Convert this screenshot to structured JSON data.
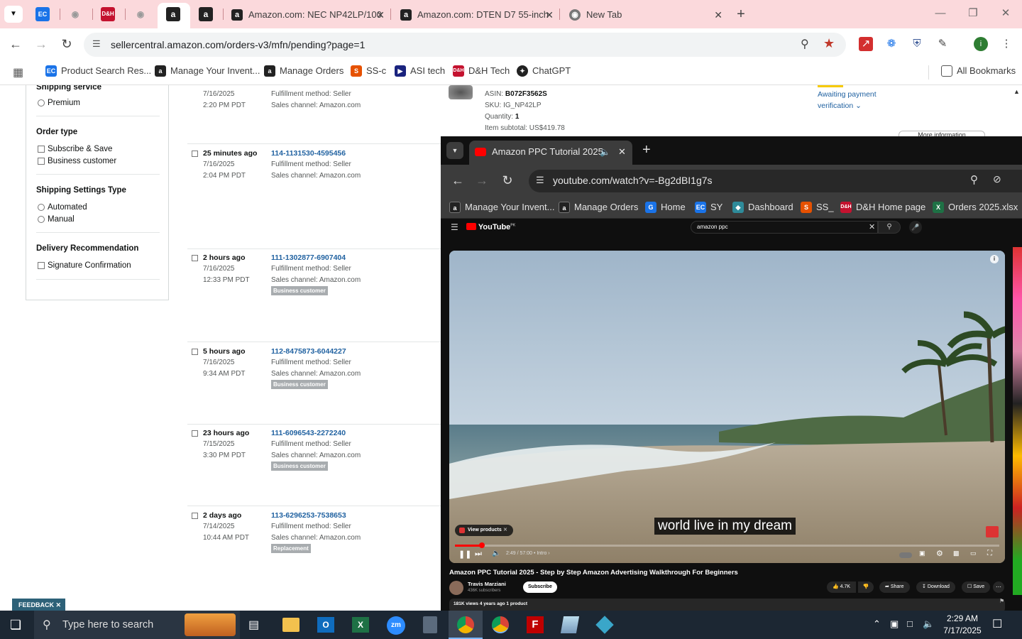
{
  "browser": {
    "tabs": [
      {
        "label": "Amazon.com: NEC NP42LP/100"
      },
      {
        "label": "Amazon.com: DTEN D7 55-inch"
      },
      {
        "label": "New Tab"
      }
    ],
    "url": "sellercentral.amazon.com/orders-v3/mfn/pending?page=1",
    "bookmarks": [
      {
        "label": "Product Search Res..."
      },
      {
        "label": "Manage Your Invent..."
      },
      {
        "label": "Manage Orders"
      },
      {
        "label": "SS-c"
      },
      {
        "label": "ASI tech"
      },
      {
        "label": "D&H Tech"
      },
      {
        "label": "ChatGPT"
      }
    ],
    "all_bookmarks": "All Bookmarks"
  },
  "filters": {
    "shipping_service": {
      "heading": "Shipping service",
      "options": [
        "Premium"
      ]
    },
    "order_type": {
      "heading": "Order type",
      "options": [
        "Subscribe & Save",
        "Business customer"
      ]
    },
    "shipping_settings": {
      "heading": "Shipping Settings Type",
      "options": [
        "Automated",
        "Manual"
      ]
    },
    "delivery": {
      "heading": "Delivery Recommendation",
      "options": [
        "Signature Confirmation"
      ]
    }
  },
  "top_order": {
    "date": "7/16/2025",
    "time": "2:20 PM PDT",
    "method": "Fulfillment method: Seller",
    "channel": "Sales channel: Amazon.com",
    "asin_label": "ASIN:",
    "asin": "B072F3562S",
    "sku": "SKU: IG_NP42LP",
    "quantity_label": "Quantity:",
    "quantity": "1",
    "subtotal": "Item subtotal: US$419.78",
    "status_line1": "Awaiting payment",
    "status_line2": "verification",
    "more_info": "More information"
  },
  "orders": [
    {
      "when": "25 minutes ago",
      "date": "7/16/2025",
      "time": "2:04 PM PDT",
      "id": "114-1131530-4595456",
      "method": "Fulfillment method: Seller",
      "channel": "Sales channel: Amazon.com",
      "badge": ""
    },
    {
      "when": "2 hours ago",
      "date": "7/16/2025",
      "time": "12:33 PM PDT",
      "id": "111-1302877-6907404",
      "method": "Fulfillment method: Seller",
      "channel": "Sales channel: Amazon.com",
      "badge": "Business customer"
    },
    {
      "when": "5 hours ago",
      "date": "7/16/2025",
      "time": "9:34 AM PDT",
      "id": "112-8475873-6044227",
      "method": "Fulfillment method: Seller",
      "channel": "Sales channel: Amazon.com",
      "badge": "Business customer"
    },
    {
      "when": "23 hours ago",
      "date": "7/15/2025",
      "time": "3:30 PM PDT",
      "id": "111-6096543-2272240",
      "method": "Fulfillment method: Seller",
      "channel": "Sales channel: Amazon.com",
      "badge": "Business customer"
    },
    {
      "when": "2 days ago",
      "date": "7/14/2025",
      "time": "10:44 AM PDT",
      "id": "113-6296253-7538653",
      "method": "Fulfillment method: Seller",
      "channel": "Sales channel: Amazon.com",
      "badge": "Replacement"
    }
  ],
  "feedback": "FEEDBACK",
  "youtube_window": {
    "tab_title": "Amazon PPC Tutorial 2025",
    "url": "youtube.com/watch?v=-Bg2dBI1g7s",
    "bookmarks": [
      {
        "label": "Manage Your Invent..."
      },
      {
        "label": "Manage Orders"
      },
      {
        "label": "Home"
      },
      {
        "label": "SY"
      },
      {
        "label": "Dashboard"
      },
      {
        "label": "SS_"
      },
      {
        "label": "D&H Home page"
      },
      {
        "label": "Orders 2025.xlsx"
      }
    ],
    "logo": "YouTube",
    "logo_sup": "PK",
    "search_value": "amazon ppc",
    "subtitle": "world live in my dream",
    "view_products": "View products",
    "time": "2:49 / 57:00",
    "chapter": "• Intro",
    "progress": 0.05,
    "video_title": "Amazon PPC Tutorial 2025 - Step by Step Amazon Advertising Walkthrough For Beginners",
    "channel": "Travis Marziani",
    "subscribers": "436K subscribers",
    "subscribe": "Subscribe",
    "likes": "4.7K",
    "share": "Share",
    "download": "Download",
    "save": "Save",
    "views": "181K views  4 years ago  1 product"
  },
  "taskbar": {
    "search_placeholder": "Type here to search",
    "time": "2:29 AM",
    "date": "7/17/2025"
  }
}
